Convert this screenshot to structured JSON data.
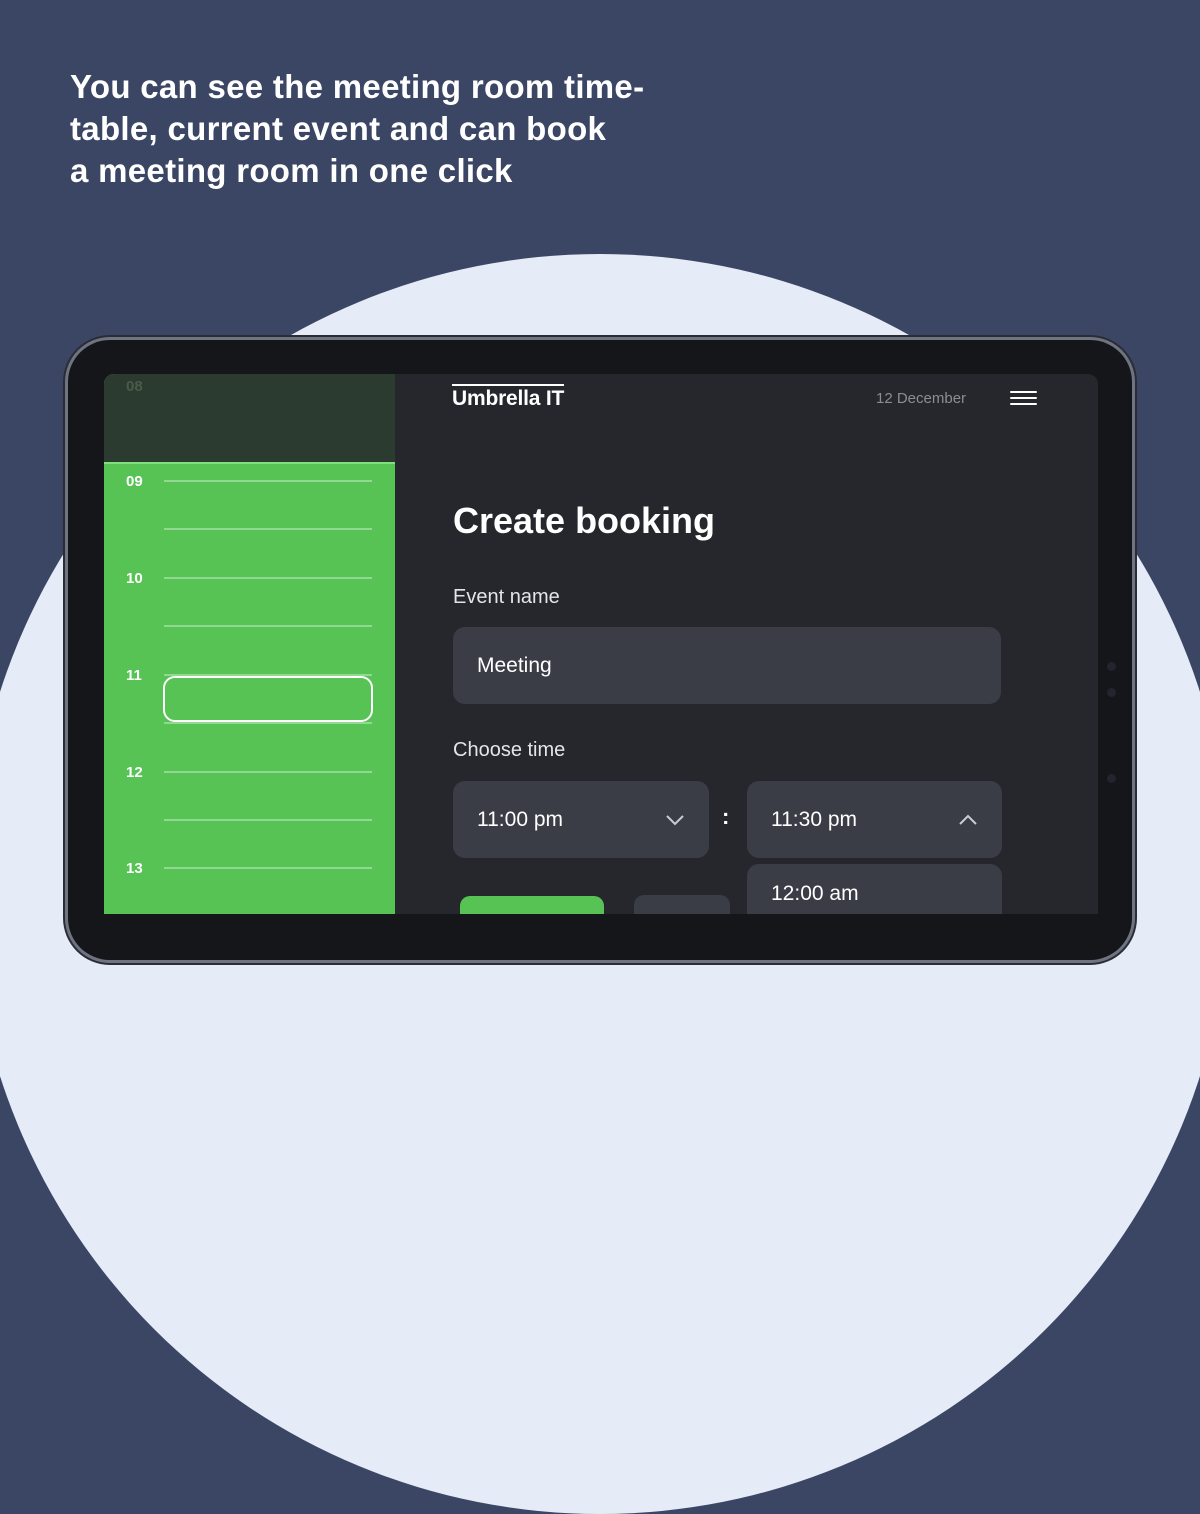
{
  "headline": {
    "line1": "You can see the meeting room time-",
    "line2": "table, current event and can book",
    "line3": "a meeting room in one click"
  },
  "app": {
    "logo": "Umbrella IT",
    "date": "12 December"
  },
  "timeline": {
    "hours": [
      "08",
      "09",
      "10",
      "11",
      "12",
      "13"
    ]
  },
  "form": {
    "title": "Create booking",
    "event_name_label": "Event name",
    "event_name_value": "Meeting",
    "choose_time_label": "Choose time",
    "start_time": "11:00 pm",
    "separator": ":",
    "end_time": "11:30 pm",
    "end_time_option": "12:00 am"
  },
  "colors": {
    "background": "#3b4665",
    "accent_green": "#57c355",
    "screen": "#25272c"
  }
}
